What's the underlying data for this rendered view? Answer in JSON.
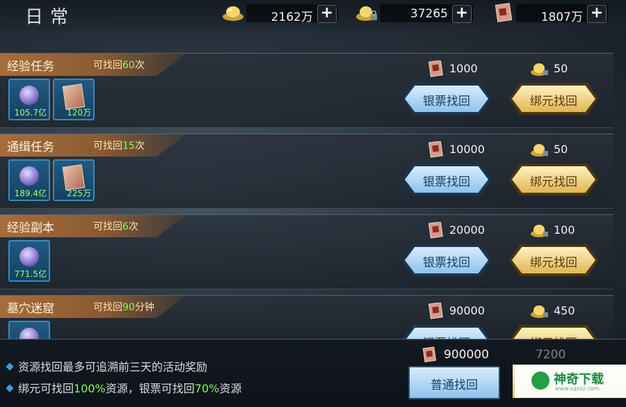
{
  "header": {
    "title": "日常",
    "resources": [
      {
        "icon": "silver-ingot-icon",
        "value": "2162万"
      },
      {
        "icon": "locked-gold-ingot-icon",
        "value": "37265"
      },
      {
        "icon": "silver-note-icon",
        "value": "1807万"
      }
    ],
    "plus": "+"
  },
  "tasks": [
    {
      "name": "经验任务",
      "count_prefix": "可找回",
      "count_value": "60",
      "count_suffix": "次",
      "rewards": [
        {
          "icon": "exp-orb-icon",
          "amount": "105.7亿"
        },
        {
          "icon": "silver-note-icon",
          "amount": "120万"
        }
      ],
      "silver_cost": "1000",
      "bound_cost": "50"
    },
    {
      "name": "通缉任务",
      "count_prefix": "可找回",
      "count_value": "15",
      "count_suffix": "次",
      "rewards": [
        {
          "icon": "exp-orb-icon",
          "amount": "189.4亿"
        },
        {
          "icon": "silver-note-icon",
          "amount": "225万"
        }
      ],
      "silver_cost": "10000",
      "bound_cost": "50"
    },
    {
      "name": "经验副本",
      "count_prefix": "可找回",
      "count_value": "6",
      "count_suffix": "次",
      "rewards": [
        {
          "icon": "exp-orb-icon",
          "amount": "771.5亿"
        }
      ],
      "silver_cost": "20000",
      "bound_cost": "100"
    },
    {
      "name": "墓穴迷窟",
      "count_prefix": "可找回",
      "count_value": "90",
      "count_suffix": "分钟",
      "rewards": [
        {
          "icon": "exp-orb-icon",
          "amount": ""
        }
      ],
      "silver_cost": "90000",
      "bound_cost": "450"
    }
  ],
  "buttons": {
    "silver_retrieve": "银票找回",
    "bound_retrieve": "绑元找回",
    "normal_retrieve": "普通找回"
  },
  "footer": {
    "tip1": "资源找回最多可追溯前三天的活动奖励",
    "tip2_a": "绑元可找回",
    "tip2_b": "100%",
    "tip2_c": "资源，银票可找回",
    "tip2_d": "70%",
    "tip2_e": "资源",
    "total_silver": "900000",
    "total_bound": "7200",
    "watermark": "神奇下载",
    "watermark_url": "www.sqxzz.com"
  },
  "colors": {
    "highlight_green": "#7dff55",
    "ribbon": "#a66d3c",
    "blue_button": "#8ec3ec",
    "gold_button": "#e0b654"
  }
}
